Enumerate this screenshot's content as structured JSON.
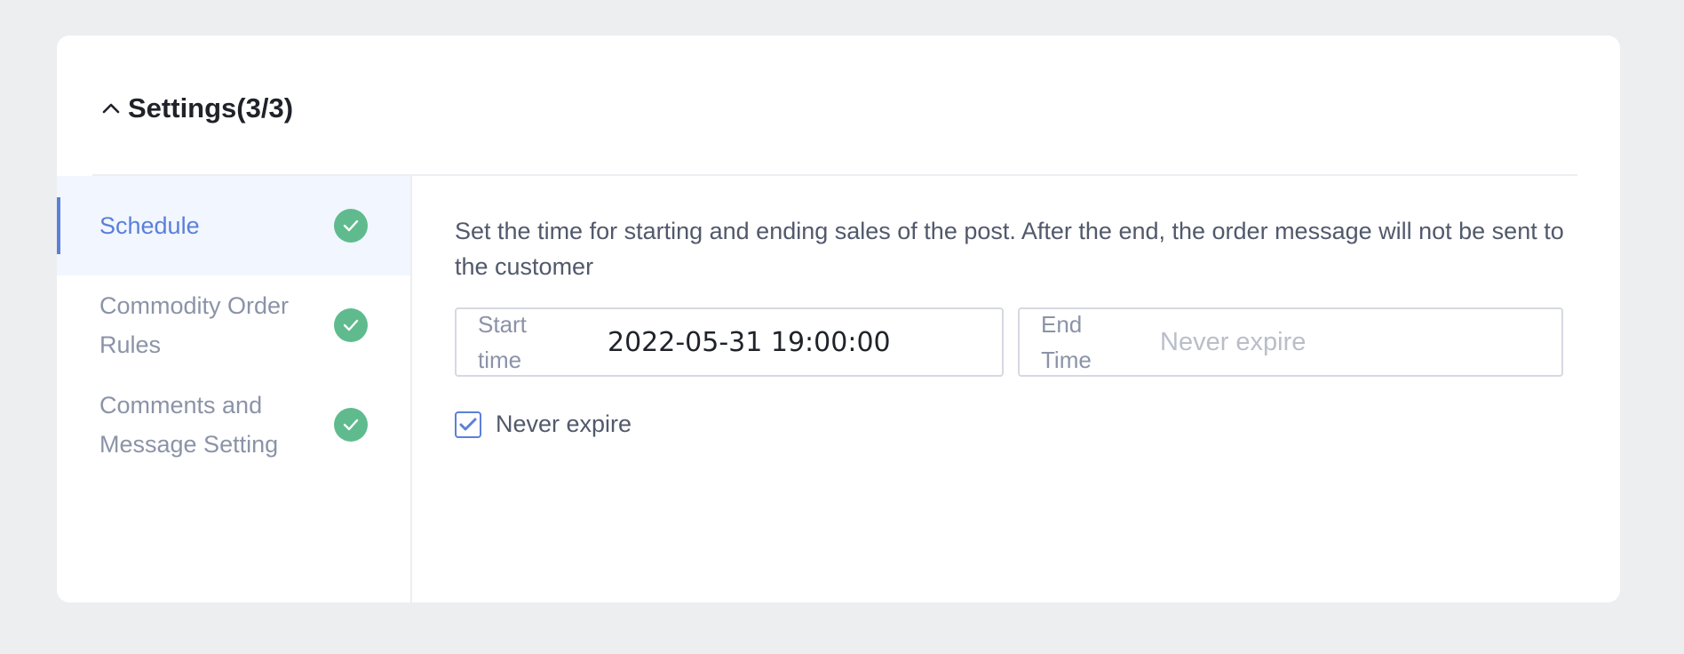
{
  "header": {
    "title": "Settings(3/3)",
    "collapse_icon": "chevron-up-icon"
  },
  "sidebar": {
    "items": [
      {
        "label": "Schedule",
        "active": true,
        "status_icon": "check-circle-icon"
      },
      {
        "label": "Commodity Order Rules",
        "active": false,
        "status_icon": "check-circle-icon"
      },
      {
        "label": "Comments and Message Setting",
        "active": false,
        "status_icon": "check-circle-icon"
      }
    ]
  },
  "schedule": {
    "description": "Set the time for starting and ending sales of the post. After the end, the order message will not be sent to the customer",
    "start_time": {
      "label": "Start time",
      "value": "2022-05-31 19:00:00"
    },
    "end_time": {
      "label": "End Time",
      "placeholder": "Never expire"
    },
    "never_expire": {
      "label": "Never expire",
      "checked": true
    }
  },
  "colors": {
    "accent": "#5b80d9",
    "success": "#5fbb8d",
    "page_background": "#edeef0",
    "active_item_background": "#f2f6ff"
  }
}
